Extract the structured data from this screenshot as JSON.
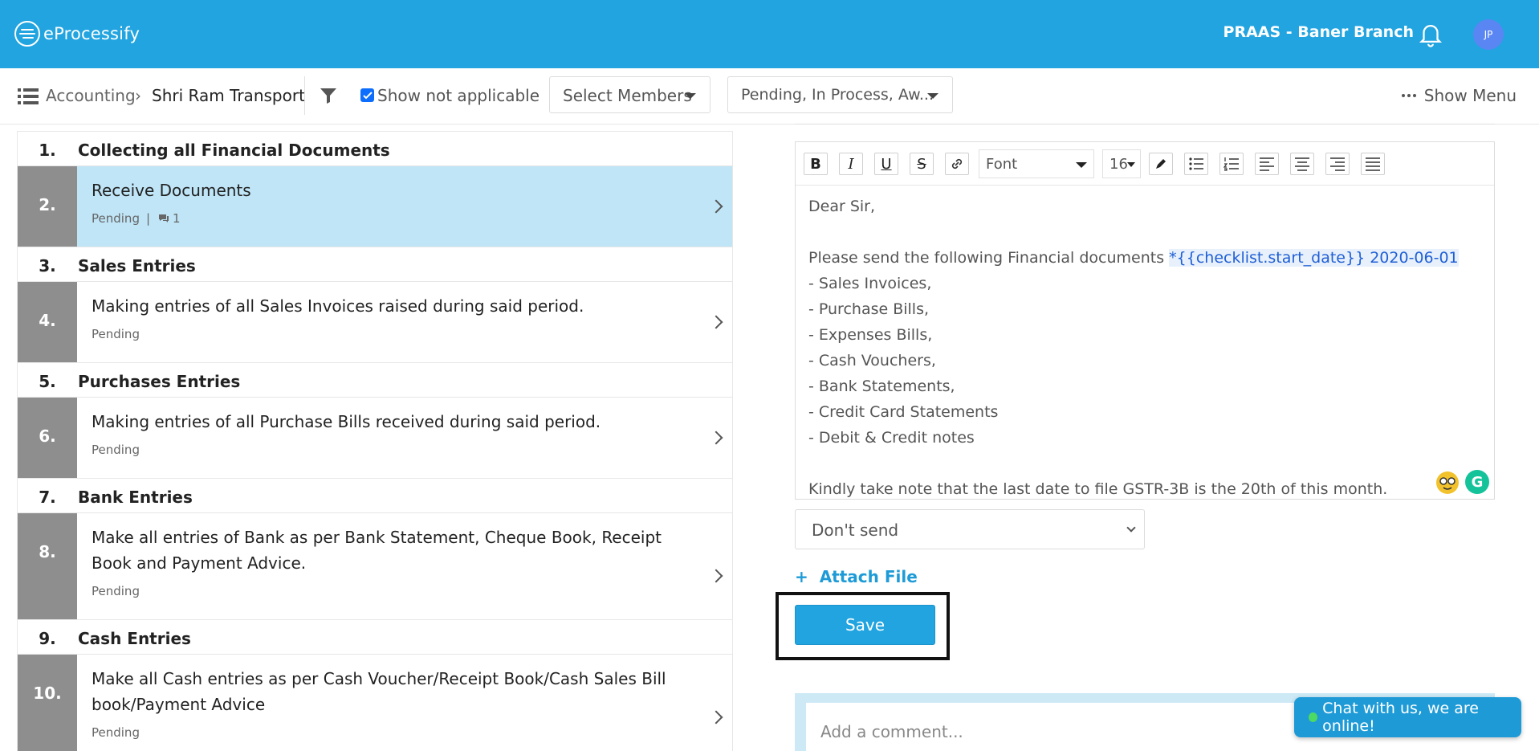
{
  "header": {
    "app_name": "eProcessify",
    "branch": "PRAAS - Baner Branch",
    "avatar_initials": "JP",
    "brand_color": "#21a4e0"
  },
  "toolbar": {
    "breadcrumb": [
      "Accounting",
      "Shri Ram Transport"
    ],
    "show_not_applicable": "Show not applicable",
    "show_not_applicable_checked": true,
    "members_dropdown": "Select Members",
    "status_dropdown": "Pending, In Process, Aw...",
    "show_menu": "Show Menu"
  },
  "checklist": {
    "sections": [
      {
        "num": "1.",
        "title": "Collecting all Financial Documents",
        "tasks": [
          {
            "num": "2.",
            "title": "Receive Documents",
            "status": "Pending",
            "comments": "1",
            "active": true
          }
        ]
      },
      {
        "num": "3.",
        "title": "Sales Entries",
        "tasks": [
          {
            "num": "4.",
            "title": "Making entries of all Sales Invoices raised during said period.",
            "status": "Pending"
          }
        ]
      },
      {
        "num": "5.",
        "title": "Purchases Entries",
        "tasks": [
          {
            "num": "6.",
            "title": "Making entries of all Purchase Bills received during said period.",
            "status": "Pending"
          }
        ]
      },
      {
        "num": "7.",
        "title": "Bank Entries",
        "tasks": [
          {
            "num": "8.",
            "title": "Make all entries of Bank as per Bank Statement, Cheque Book, Receipt Book and Payment Advice.",
            "status": "Pending"
          }
        ]
      },
      {
        "num": "9.",
        "title": "Cash Entries",
        "tasks": [
          {
            "num": "10.",
            "title": "Make all Cash entries as per Cash Voucher/Receipt Book/Cash Sales Bill book/Payment Advice",
            "status": "Pending"
          }
        ]
      }
    ]
  },
  "editor": {
    "font_label": "Font",
    "size_label": "16",
    "greeting": "Dear Sir,",
    "intro": "Please send the following Financial documents",
    "template_var": "*{{checklist.start_date}} 2020-06-01",
    "items": [
      "- Sales Invoices,",
      "- Purchase Bills,",
      "- Expenses Bills,",
      "- Cash Vouchers,",
      "- Bank Statements,",
      "- Credit Card Statements",
      "- Debit & Credit notes"
    ],
    "closing": "Kindly take note that the last date to file GSTR-3B is the 20th of this month."
  },
  "send_option": "Don't send",
  "attach_label": "Attach File",
  "attach_plus": "+",
  "save_label": "Save",
  "comment_placeholder": "Add a comment...",
  "chat_label": "Chat with us, we are online!"
}
